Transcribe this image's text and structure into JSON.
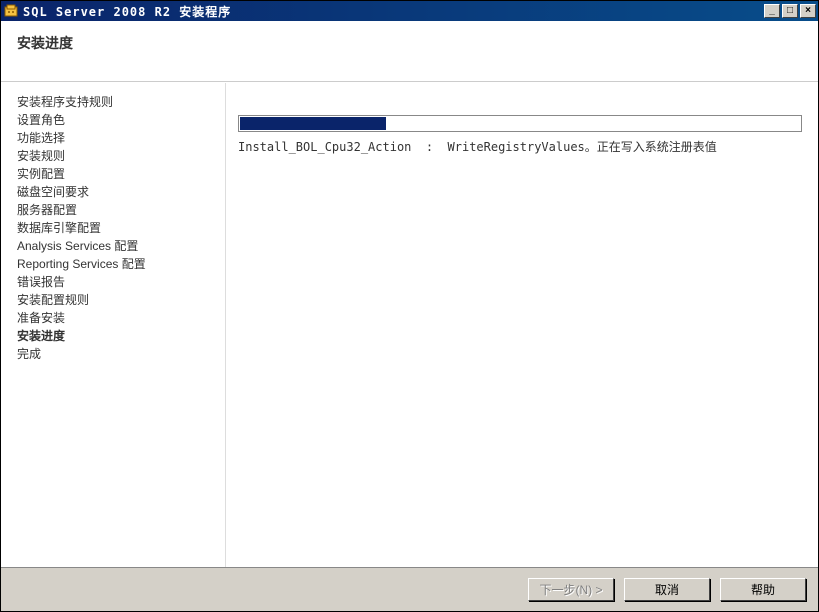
{
  "window": {
    "title": "SQL Server 2008 R2 安装程序"
  },
  "header": {
    "title": "安装进度"
  },
  "sidebar": {
    "steps": [
      {
        "label": "安装程序支持规则",
        "current": false
      },
      {
        "label": "设置角色",
        "current": false
      },
      {
        "label": "功能选择",
        "current": false
      },
      {
        "label": "安装规则",
        "current": false
      },
      {
        "label": "实例配置",
        "current": false
      },
      {
        "label": "磁盘空间要求",
        "current": false
      },
      {
        "label": "服务器配置",
        "current": false
      },
      {
        "label": "数据库引擎配置",
        "current": false
      },
      {
        "label": "Analysis Services 配置",
        "current": false
      },
      {
        "label": "Reporting Services 配置",
        "current": false
      },
      {
        "label": "错误报告",
        "current": false
      },
      {
        "label": "安装配置规则",
        "current": false
      },
      {
        "label": "准备安装",
        "current": false
      },
      {
        "label": "安装进度",
        "current": true
      },
      {
        "label": "完成",
        "current": false
      }
    ]
  },
  "progress": {
    "percent": 26,
    "status": "Install_BOL_Cpu32_Action  :  WriteRegistryValues。正在写入系统注册表值"
  },
  "buttons": {
    "next": "下一步(N) >",
    "cancel": "取消",
    "help": "帮助"
  }
}
